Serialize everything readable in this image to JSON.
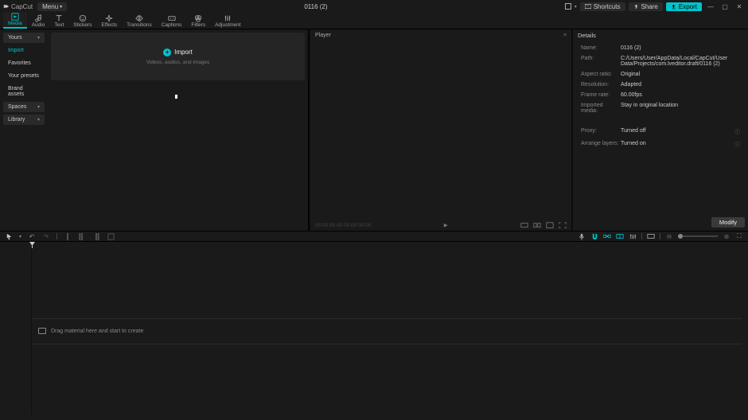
{
  "titlebar": {
    "app": "CapCut",
    "menu": "Menu",
    "project": "0116 (2)",
    "shortcuts": "Shortcuts",
    "share": "Share",
    "export": "Export"
  },
  "tooltabs": [
    {
      "label": "Media",
      "active": true
    },
    {
      "label": "Audio"
    },
    {
      "label": "Text"
    },
    {
      "label": "Stickers"
    },
    {
      "label": "Effects"
    },
    {
      "label": "Transitions"
    },
    {
      "label": "Captions"
    },
    {
      "label": "Filters"
    },
    {
      "label": "Adjustment"
    }
  ],
  "mediaSide": {
    "yours": "Yours",
    "import": "Import",
    "favorites": "Favorites",
    "presets": "Your presets",
    "brand": "Brand assets",
    "spaces": "Spaces",
    "library": "Library"
  },
  "importBox": {
    "label": "Import",
    "sub": "Videos, audios, and images"
  },
  "player": {
    "title": "Player",
    "time": "00:00:00:00   00:00:00:00"
  },
  "details": {
    "title": "Details",
    "rows": {
      "name_l": "Name:",
      "name_v": "0116 (2)",
      "path_l": "Path:",
      "path_v": "C:/Users/User/AppData/Local/CapCut/User Data/Projects/com.lveditor.draft/0116 (2)",
      "aspect_l": "Aspect ratio:",
      "aspect_v": "Original",
      "res_l": "Resolution:",
      "res_v": "Adapted",
      "fps_l": "Frame rate:",
      "fps_v": "60.00fps",
      "imp_l": "Imported media:",
      "imp_v": "Stay in original location",
      "proxy_l": "Proxy:",
      "proxy_v": "Turned off",
      "layers_l": "Arrange layers:",
      "layers_v": "Turned on"
    },
    "modify": "Modify"
  },
  "timeline": {
    "drop": "Drag material here and start to create"
  }
}
